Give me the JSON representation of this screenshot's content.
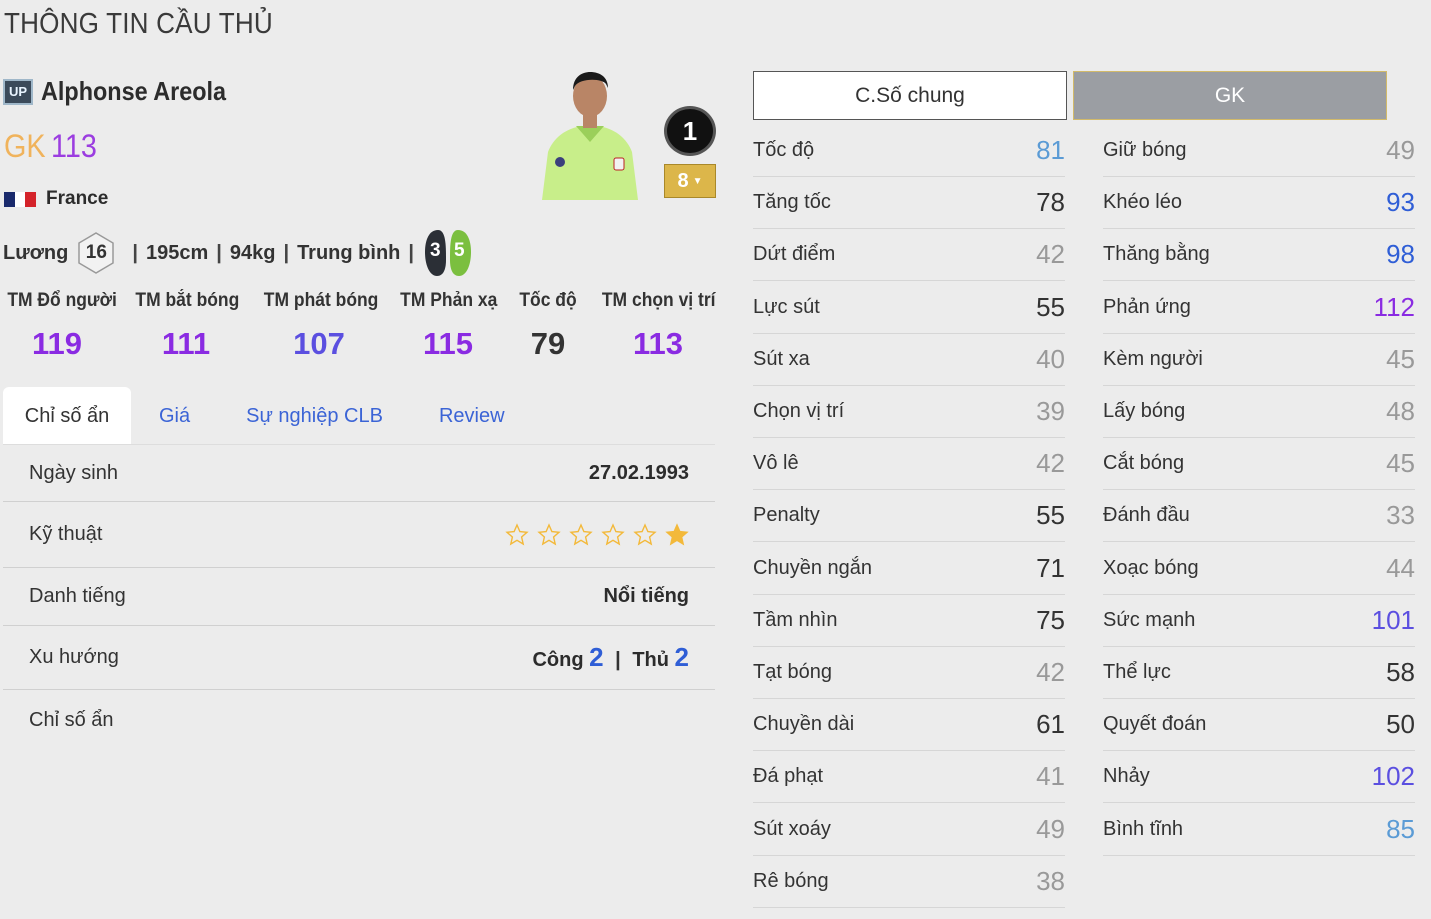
{
  "page_title": "THÔNG TIN CẦU THỦ",
  "player": {
    "season_badge": "UP",
    "name": "Alphonse Areola",
    "position": "GK",
    "overall": "113",
    "nation": "France",
    "rank_badge": "1",
    "upgrade_level": "8"
  },
  "info": {
    "salary_label": "Lương",
    "salary": "16",
    "height": "195cm",
    "weight": "94kg",
    "body_type": "Trung bình",
    "left_foot": "3",
    "right_foot": "5"
  },
  "sub_stats": [
    {
      "label": "TM Đổ người",
      "value": "119",
      "color": "#8a2be2"
    },
    {
      "label": "TM bắt bóng",
      "value": "111",
      "color": "#8a2be2"
    },
    {
      "label": "TM phát bóng",
      "value": "107",
      "color": "#5b4fe0"
    },
    {
      "label": "TM Phản xạ",
      "value": "115",
      "color": "#8a2be2"
    },
    {
      "label": "Tốc độ",
      "value": "79",
      "color": "#333333"
    },
    {
      "label": "TM chọn vị trí",
      "value": "113",
      "color": "#8a2be2"
    }
  ],
  "tabs": [
    "Chỉ số ẩn",
    "Giá",
    "Sự nghiệp CLB",
    "Review"
  ],
  "details": {
    "birth_label": "Ngày sinh",
    "birth_value": "27.02.1993",
    "skill_label": "Kỹ thuật",
    "skill_stars_filled": 1,
    "skill_stars_total": 6,
    "fame_label": "Danh tiếng",
    "fame_value": "Nổi tiếng",
    "trend_label": "Xu hướng",
    "attack_label": "Công",
    "attack_value": "2",
    "defense_label": "Thủ",
    "defense_value": "2",
    "hidden_label": "Chỉ số ẩn"
  },
  "toggle": {
    "general": "C.Số chung",
    "gk": "GK"
  },
  "attributes_left": [
    {
      "name": "Tốc độ",
      "value": "81",
      "color": "#5b9bd5"
    },
    {
      "name": "Tăng tốc",
      "value": "78",
      "color": "#333333"
    },
    {
      "name": "Dứt điểm",
      "value": "42",
      "color": "#999999"
    },
    {
      "name": "Lực sút",
      "value": "55",
      "color": "#333333"
    },
    {
      "name": "Sút xa",
      "value": "40",
      "color": "#999999"
    },
    {
      "name": "Chọn vị trí",
      "value": "39",
      "color": "#999999"
    },
    {
      "name": "Vô lê",
      "value": "42",
      "color": "#999999"
    },
    {
      "name": "Penalty",
      "value": "55",
      "color": "#333333"
    },
    {
      "name": "Chuyền ngắn",
      "value": "71",
      "color": "#333333"
    },
    {
      "name": "Tầm nhìn",
      "value": "75",
      "color": "#333333"
    },
    {
      "name": "Tạt bóng",
      "value": "42",
      "color": "#999999"
    },
    {
      "name": "Chuyền dài",
      "value": "61",
      "color": "#333333"
    },
    {
      "name": "Đá phạt",
      "value": "41",
      "color": "#999999"
    },
    {
      "name": "Sút xoáy",
      "value": "49",
      "color": "#999999"
    },
    {
      "name": "Rê bóng",
      "value": "38",
      "color": "#999999"
    }
  ],
  "attributes_right": [
    {
      "name": "Giữ bóng",
      "value": "49",
      "color": "#999999"
    },
    {
      "name": "Khéo léo",
      "value": "93",
      "color": "#2f5ed6"
    },
    {
      "name": "Thăng bằng",
      "value": "98",
      "color": "#2f5ed6"
    },
    {
      "name": "Phản ứng",
      "value": "112",
      "color": "#8a2be2"
    },
    {
      "name": "Kèm người",
      "value": "45",
      "color": "#999999"
    },
    {
      "name": "Lấy bóng",
      "value": "48",
      "color": "#999999"
    },
    {
      "name": "Cắt bóng",
      "value": "45",
      "color": "#999999"
    },
    {
      "name": "Đánh đầu",
      "value": "33",
      "color": "#999999"
    },
    {
      "name": "Xoạc bóng",
      "value": "44",
      "color": "#999999"
    },
    {
      "name": "Sức mạnh",
      "value": "101",
      "color": "#5b4fe0"
    },
    {
      "name": "Thể lực",
      "value": "58",
      "color": "#333333"
    },
    {
      "name": "Quyết đoán",
      "value": "50",
      "color": "#333333"
    },
    {
      "name": "Nhảy",
      "value": "102",
      "color": "#5b4fe0"
    },
    {
      "name": "Bình tĩnh",
      "value": "85",
      "color": "#5b9bd5"
    }
  ],
  "colors": {
    "position": "#f0b35c",
    "overall": "#9b3de0",
    "tab_link": "#3b64d6",
    "star": "#f3b93a",
    "flag_blue": "#1a2a6c",
    "flag_red": "#d4232a",
    "foot_left": "#2b2f36",
    "foot_right": "#7bbf3f"
  }
}
